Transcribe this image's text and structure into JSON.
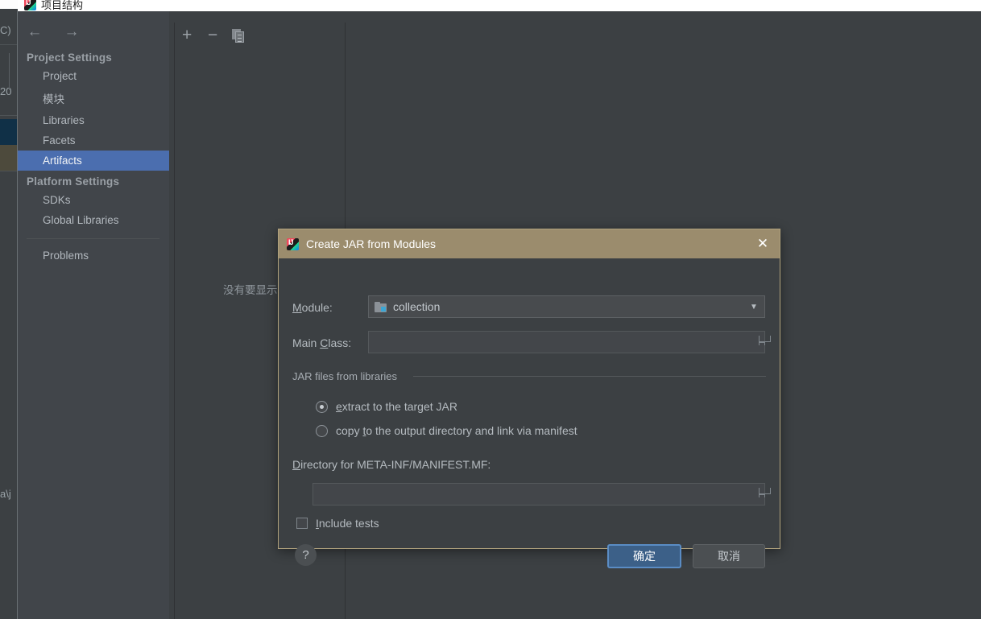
{
  "window": {
    "app_title": "项目结构",
    "logo_icon": "intellij-idea-logo"
  },
  "edge_fragments": {
    "top_left": "C)",
    "mid_left": "20",
    "bottom_left": "a\\j"
  },
  "project_structure": {
    "nav": {
      "back_icon": "arrow-left-icon",
      "forward_icon": "arrow-right-icon"
    },
    "sections": [
      {
        "title": "Project Settings",
        "items": [
          {
            "label": "Project",
            "selected": false
          },
          {
            "label": "模块",
            "selected": false
          },
          {
            "label": "Libraries",
            "selected": false
          },
          {
            "label": "Facets",
            "selected": false
          },
          {
            "label": "Artifacts",
            "selected": true
          }
        ]
      },
      {
        "title": "Platform Settings",
        "items": [
          {
            "label": "SDKs",
            "selected": false
          },
          {
            "label": "Global Libraries",
            "selected": false
          }
        ]
      }
    ],
    "extra_items": [
      {
        "label": "Problems",
        "selected": false
      }
    ],
    "toolbar": {
      "add_icon": "plus-icon",
      "remove_icon": "minus-icon",
      "copy_icon": "copy-icon"
    },
    "empty_message": "没有要显示的"
  },
  "jar_dialog": {
    "title": "Create JAR from Modules",
    "title_icon": "intellij-idea-logo",
    "close_label": "✕",
    "module": {
      "label": "Module:",
      "label_mnemonic": "M",
      "value": "collection",
      "icon": "module-folder-icon",
      "dropdown_arrow": "▼"
    },
    "main_class": {
      "label": "Main Class:",
      "label_mnemonic": "C",
      "value": "",
      "browse_icon": "folder-browse-icon"
    },
    "libraries_group": {
      "title": "JAR files from libraries",
      "options": [
        {
          "label": "extract to the target JAR",
          "mnemonic": "e",
          "selected": true
        },
        {
          "label": "copy to the output directory and link via manifest",
          "mnemonic": "t",
          "selected": false
        }
      ]
    },
    "manifest_dir": {
      "label": "Directory for META-INF/MANIFEST.MF:",
      "label_mnemonic": "D",
      "value": "",
      "browse_icon": "folder-browse-icon"
    },
    "include_tests": {
      "label": "Include tests",
      "mnemonic": "I",
      "checked": false
    },
    "help_label": "?",
    "buttons": {
      "ok": "确定",
      "cancel": "取消"
    }
  },
  "colors": {
    "dialog_title_bar": "#9b8c6d",
    "dialog_border": "#b2a37e",
    "selection_blue": "#4b6eaf",
    "primary_button": "#3c6088",
    "primary_button_border": "#5a8cc4",
    "panel_bg": "#3c4043",
    "sidebar_bg": "#41454a",
    "module_icon_accent": "#3ba6d4"
  }
}
